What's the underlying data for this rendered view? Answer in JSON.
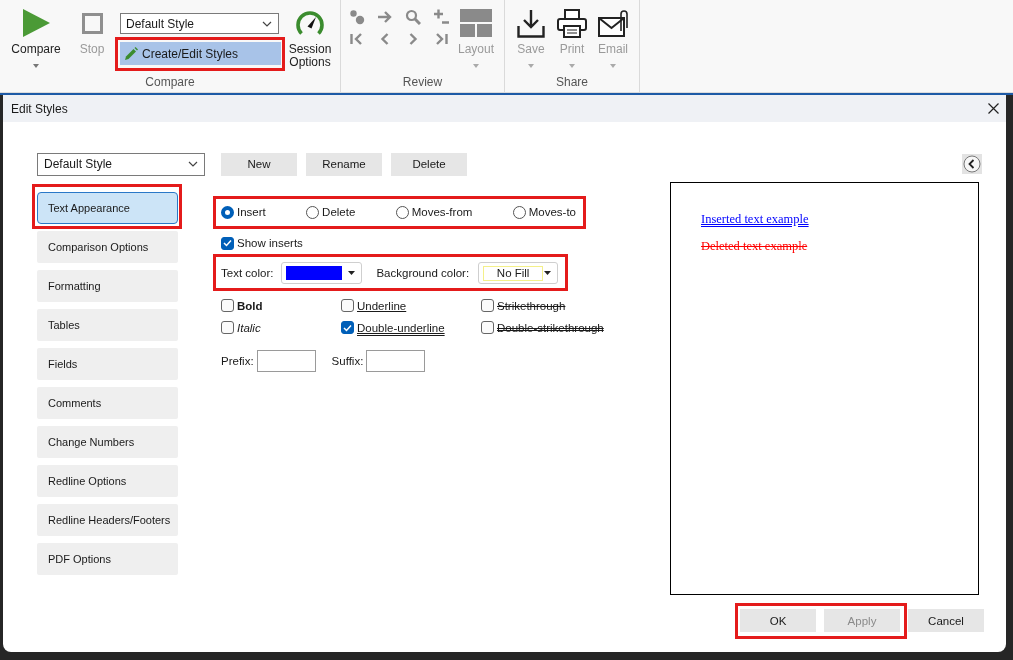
{
  "ribbon": {
    "compare": {
      "group_label": "Compare",
      "compare_button": {
        "label": "Compare",
        "disabled": false
      },
      "stop_button": {
        "label": "Stop",
        "disabled": true
      },
      "style_select": {
        "value": "Default Style"
      },
      "edit_styles_button": {
        "label": "Create/Edit Styles",
        "hovered": true,
        "highlighted": true
      },
      "session_options_button": {
        "label": "Session Options",
        "disabled": false
      }
    },
    "review": {
      "group_label": "Review",
      "nav_buttons": [
        {
          "disabled": true
        },
        {
          "disabled": true
        },
        {
          "disabled": true
        },
        {
          "disabled": true
        },
        {
          "disabled": true
        },
        {
          "disabled": true
        },
        {
          "disabled": true
        },
        {
          "disabled": true
        }
      ],
      "layout_button": {
        "label": "Layout",
        "disabled": true
      }
    },
    "share": {
      "group_label": "Share",
      "buttons": [
        {
          "label": "Save",
          "disabled": true
        },
        {
          "label": "Print",
          "disabled": true
        },
        {
          "label": "Email",
          "disabled": true
        }
      ]
    }
  },
  "dialog": {
    "title": "Edit Styles",
    "style_select": {
      "value": "Default Style"
    },
    "style_buttons": [
      "New",
      "Rename",
      "Delete"
    ],
    "sidebar": [
      {
        "label": "Text Appearance",
        "selected": true,
        "highlighted": true
      },
      {
        "label": "Comparison Options",
        "selected": false,
        "highlighted": false
      },
      {
        "label": "Formatting",
        "selected": false,
        "highlighted": false
      },
      {
        "label": "Tables",
        "selected": false,
        "highlighted": false
      },
      {
        "label": "Fields",
        "selected": false,
        "highlighted": false
      },
      {
        "label": "Comments",
        "selected": false,
        "highlighted": false
      },
      {
        "label": "Change Numbers",
        "selected": false,
        "highlighted": false
      },
      {
        "label": "Redline Options",
        "selected": false,
        "highlighted": false
      },
      {
        "label": "Redline Headers/Footers",
        "selected": false,
        "highlighted": false
      },
      {
        "label": "PDF Options",
        "selected": false,
        "highlighted": false
      }
    ],
    "change_types": {
      "highlighted": true,
      "options": [
        {
          "label": "Insert",
          "selected": true
        },
        {
          "label": "Delete",
          "selected": false
        },
        {
          "label": "Moves-from",
          "selected": false
        },
        {
          "label": "Moves-to",
          "selected": false
        }
      ]
    },
    "show_inserts": {
      "label": "Show inserts",
      "checked": true
    },
    "colors": {
      "highlighted": true,
      "text_color": {
        "label": "Text color:",
        "color": "#0000ff"
      },
      "background_color": {
        "label": "Background color:",
        "value": "No Fill"
      }
    },
    "formatting": [
      {
        "label": "Bold",
        "kind": "bold",
        "checked": false
      },
      {
        "label": "Underline",
        "kind": "underline",
        "checked": false
      },
      {
        "label": "Strikethrough",
        "kind": "strikethrough",
        "checked": false
      },
      {
        "label": "Italic",
        "kind": "italic",
        "checked": false
      },
      {
        "label": "Double-underline",
        "kind": "double-underline",
        "checked": true
      },
      {
        "label": "Double-strikethrough",
        "kind": "double-strikethrough",
        "checked": false
      }
    ],
    "prefix": {
      "label": "Prefix:"
    },
    "suffix": {
      "label": "Suffix:"
    },
    "preview": [
      {
        "text": "Inserted text example",
        "kind": "inserted",
        "color": "#0000ff"
      },
      {
        "text": "Deleted text example",
        "kind": "deleted",
        "color": "#ff0000"
      }
    ],
    "footer_buttons": [
      {
        "label": "OK",
        "disabled": false,
        "highlighted": true
      },
      {
        "label": "Apply",
        "disabled": true,
        "highlighted": true
      },
      {
        "label": "Cancel",
        "disabled": false,
        "highlighted": false
      }
    ]
  }
}
